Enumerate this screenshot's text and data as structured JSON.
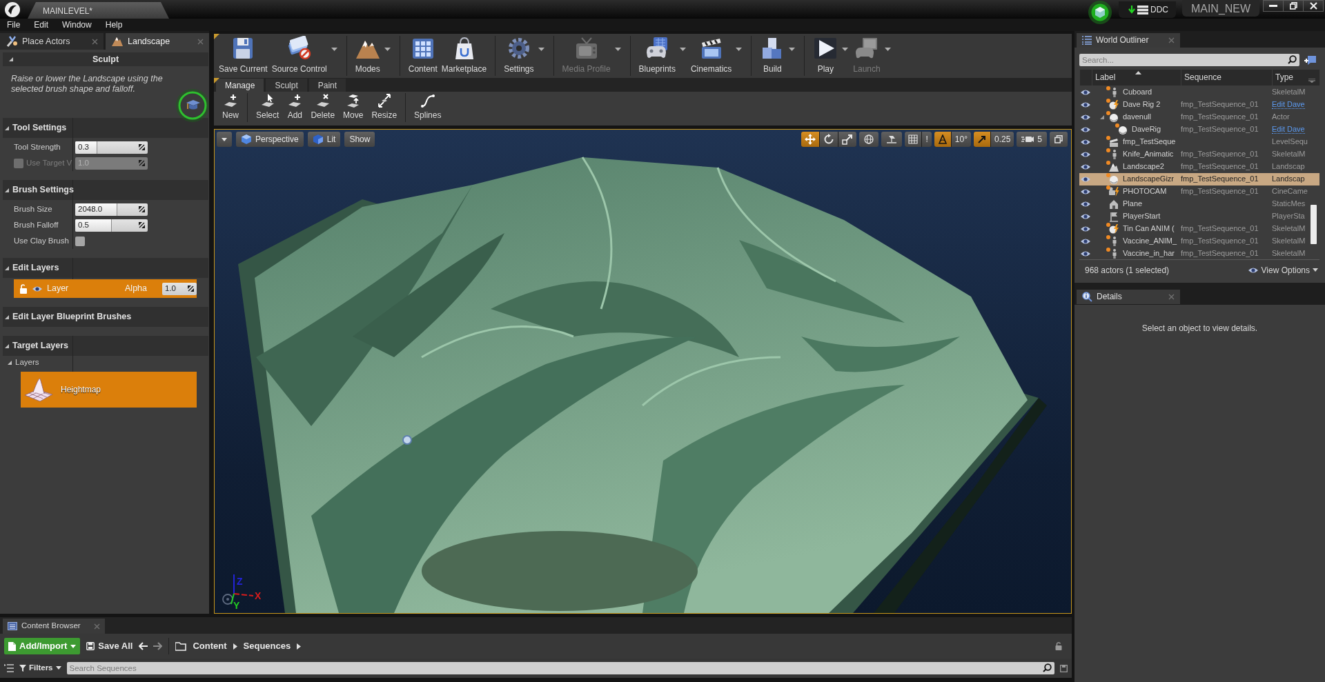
{
  "title_bar": {
    "level_tab": "MAINLEVEL*",
    "ddc_label": "DDC",
    "project": "MAIN_NEW"
  },
  "menu": [
    "File",
    "Edit",
    "Window",
    "Help"
  ],
  "left_panel": {
    "tabs": [
      {
        "label": "Place Actors",
        "selected": false
      },
      {
        "label": "Landscape",
        "selected": true
      }
    ],
    "tool_title": "Sculpt",
    "tool_expanded": true,
    "description": "Raise or lower the Landscape using the selected brush shape and falloff.",
    "sections": [
      {
        "title": "Tool Settings",
        "expanded": true,
        "rows": [
          {
            "kind": "slider",
            "label": "Tool Strength",
            "value": "0.3",
            "level": 0.3
          },
          {
            "kind": "check_field",
            "label": "Use Target V",
            "value": "1.0",
            "checked": false,
            "disabled": true
          }
        ]
      },
      {
        "title": "Brush Settings",
        "expanded": true,
        "rows": [
          {
            "kind": "slider",
            "label": "Brush Size",
            "value": "2048.0",
            "level": 0.58
          },
          {
            "kind": "slider",
            "label": "Brush Falloff",
            "value": "0.5",
            "level": 0.5
          },
          {
            "kind": "checkbox",
            "label": "Use Clay Brush",
            "checked": false
          }
        ]
      },
      {
        "title": "Edit Layers",
        "expanded": true,
        "rows": [
          {
            "kind": "layer",
            "label": "Layer",
            "alpha_label": "Alpha",
            "value": "1.0",
            "locked": false,
            "visible": true,
            "selected": true
          }
        ]
      },
      {
        "title": "Edit Layer Blueprint Brushes",
        "expanded": true
      },
      {
        "title": "Target Layers",
        "expanded": true,
        "rows": [
          {
            "kind": "group",
            "label": "Layers",
            "expanded": true
          },
          {
            "kind": "target",
            "label": "Heightmap",
            "selected": true
          }
        ]
      }
    ]
  },
  "toolbar": {
    "groups": [
      [
        {
          "label": "Save Current",
          "dropdown": false,
          "disabled": false
        },
        {
          "label": "Source Control",
          "dropdown": true,
          "disabled": false
        }
      ],
      [
        {
          "label": "Modes",
          "dropdown": true,
          "disabled": false
        }
      ],
      [
        {
          "label": "Content",
          "dropdown": false,
          "disabled": false
        },
        {
          "label": "Marketplace",
          "dropdown": false,
          "disabled": false
        }
      ],
      [
        {
          "label": "Settings",
          "dropdown": true,
          "disabled": false
        }
      ],
      [
        {
          "label": "Media Profile",
          "dropdown": true,
          "disabled": true
        }
      ],
      [
        {
          "label": "Blueprints",
          "dropdown": true,
          "disabled": false
        },
        {
          "label": "Cinematics",
          "dropdown": true,
          "disabled": false
        }
      ],
      [
        {
          "label": "Build",
          "dropdown": true,
          "disabled": false
        }
      ],
      [
        {
          "label": "Play",
          "dropdown": true,
          "disabled": false
        },
        {
          "label": "Launch",
          "dropdown": true,
          "disabled": true
        }
      ]
    ]
  },
  "mode_tabs": [
    {
      "label": "Manage",
      "selected": true
    },
    {
      "label": "Sculpt",
      "selected": false
    },
    {
      "label": "Paint",
      "selected": false
    }
  ],
  "manage_tools": [
    [
      "New"
    ],
    [
      "Select",
      "Add",
      "Delete",
      "Move",
      "Resize"
    ],
    [
      "Splines"
    ]
  ],
  "viewport": {
    "toolbar": {
      "view": "Perspective",
      "lighting": "Lit",
      "show": "Show",
      "transform_tools": [
        {
          "selected": true
        },
        {
          "selected": false
        },
        {
          "selected": false
        }
      ],
      "snaps": [
        {
          "kind": "grid",
          "on": false,
          "value": "!"
        },
        {
          "kind": "rotation",
          "on": true,
          "value": "10°"
        },
        {
          "kind": "scale",
          "on": true,
          "value": "0.25"
        }
      ],
      "camera_speed": "5"
    },
    "axis_labels": [
      {
        "text": "Z",
        "color": "#2323d8"
      },
      {
        "text": "X",
        "color": "#d81c1c"
      },
      {
        "text": "Y",
        "color": "#22cc22"
      }
    ]
  },
  "world_outliner": {
    "tab": "World Outliner",
    "search_placeholder": "Search...",
    "columns": [
      "Label",
      "Sequence",
      "Type"
    ],
    "rows": [
      {
        "kind": "skeletal",
        "label": "Cuboard",
        "type": "SkeletalM",
        "link": false,
        "dot": true,
        "visible": true,
        "selected": false
      },
      {
        "kind": "rig",
        "label": "Dave Rig 2",
        "sequence": "fmp_TestSequence_01",
        "type": "Edit Dave",
        "link": true,
        "dot": true,
        "visible": true,
        "selected": false
      },
      {
        "kind": "actor",
        "label": "davenull",
        "sequence": "fmp_TestSequence_01",
        "type": "Actor",
        "link": false,
        "dot": true,
        "visible": true,
        "selected": false,
        "expanded": true,
        "children": [
          {
            "kind": "actor",
            "label": "DaveRig",
            "sequence": "fmp_TestSequence_01",
            "type": "Edit Dave",
            "link": true,
            "dot": true,
            "visible": true,
            "selected": false
          }
        ]
      },
      {
        "kind": "sequence",
        "label": "fmp_TestSeque",
        "type": "LevelSequ",
        "link": false,
        "dot": true,
        "visible": true,
        "selected": false
      },
      {
        "kind": "skeletal",
        "label": "Knife_Animatic",
        "sequence": "fmp_TestSequence_01",
        "type": "SkeletalM",
        "link": false,
        "dot": true,
        "visible": true,
        "selected": false
      },
      {
        "kind": "landscape",
        "label": "Landscape2",
        "sequence": "fmp_TestSequence_01",
        "type": "Landscap",
        "link": false,
        "dot": true,
        "visible": true,
        "selected": false
      },
      {
        "kind": "actor",
        "label": "LandscapeGizr",
        "sequence": "fmp_TestSequence_01",
        "type": "Landscap",
        "link": false,
        "dot": true,
        "visible": true,
        "selected": true
      },
      {
        "kind": "camera",
        "label": "PHOTOCAM",
        "sequence": "fmp_TestSequence_01",
        "type": "CineCame",
        "link": false,
        "dot": true,
        "visible": true,
        "selected": false
      },
      {
        "kind": "mesh",
        "label": "Plane",
        "type": "StaticMes",
        "link": false,
        "dot": false,
        "visible": true,
        "selected": false
      },
      {
        "kind": "start",
        "label": "PlayerStart",
        "type": "PlayerSta",
        "link": false,
        "dot": false,
        "visible": true,
        "selected": false
      },
      {
        "kind": "rig",
        "label": "Tin Can ANIM (",
        "sequence": "fmp_TestSequence_01",
        "type": "SkeletalM",
        "link": false,
        "dot": true,
        "visible": true,
        "selected": false
      },
      {
        "kind": "skeletal",
        "label": "Vaccine_ANIM_",
        "sequence": "fmp_TestSequence_01",
        "type": "SkeletalM",
        "link": false,
        "dot": true,
        "visible": true,
        "selected": false
      },
      {
        "kind": "skeletal",
        "label": "Vaccine_in_har",
        "sequence": "fmp_TestSequence_01",
        "type": "SkeletalM",
        "link": false,
        "dot": true,
        "visible": true,
        "selected": false
      }
    ],
    "summary": "968 actors (1 selected)",
    "view_options": "View Options"
  },
  "details": {
    "tab": "Details",
    "message": "Select an object to view details."
  },
  "content_browser": {
    "tab": "Content Browser",
    "add_import": "Add/Import",
    "save_all": "Save All",
    "back_enabled": true,
    "forward_enabled": false,
    "path": [
      "Content",
      "Sequences"
    ],
    "filters": "Filters",
    "search_placeholder": "Search Sequences"
  }
}
